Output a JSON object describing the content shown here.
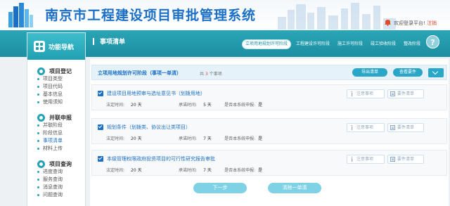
{
  "header": {
    "title": "南京市工程建设项目审批管理系统",
    "welcome": "欢迎登录平台!",
    "logout": "注销"
  },
  "sidebar": {
    "title": "功能导航",
    "groups": [
      {
        "title": "项目登记",
        "items": [
          "项目类型",
          "项目代码",
          "基本信息",
          "使用须知"
        ]
      },
      {
        "title": "并联申报",
        "items": [
          "并联阶段",
          "阶段信息",
          "事项清单",
          "材料上传"
        ]
      },
      {
        "title": "项目查询",
        "items": [
          "进度查询",
          "服务查询",
          "消息查询",
          "问题查询"
        ]
      }
    ],
    "active_item": "事项清单"
  },
  "page": {
    "title": "事项清单",
    "stages": [
      "立项用地规划许可阶段",
      "工程建设许可阶段",
      "施工许可阶段",
      "竣工验收阶段",
      "整改阶段"
    ],
    "active_stage": 0,
    "help": "?"
  },
  "summary": {
    "stage_label": "立项用地规划许可阶段（事项一单清）",
    "count_prefix": "共",
    "count": "3",
    "count_suffix": "个事项",
    "export_label": "导出清单",
    "view_label": "查看要件"
  },
  "items": [
    {
      "name": "建设项目用地预审与选址意见书（划拨用地）",
      "legal_label": "法定时间:",
      "legal": "20 天",
      "promise_label": "承诺时间:",
      "promise": "5 天",
      "online_label": "是否本系统申报:",
      "online": "是",
      "notice": "注意事项",
      "list": "要件清单"
    },
    {
      "name": "规划条件（划拨类、协议出让类项目）",
      "legal_label": "法定时间:",
      "legal": "20 天",
      "promise_label": "承诺时间:",
      "promise": "7 天",
      "online_label": "是否本系统申报:",
      "online": "是",
      "notice": "注意事项",
      "list": "要件清单"
    },
    {
      "name": "本级管理权限政府投资项目的可行性研究报告审批",
      "legal_label": "法定时间:",
      "legal": "20 天",
      "promise_label": "承诺时间:",
      "promise": "7 天",
      "online_label": "是否本系统申报:",
      "online": "是",
      "notice": "注意事项",
      "list": "要件清单"
    }
  ],
  "footer": {
    "next_label": "下一步",
    "clear_label": "清除一单清"
  },
  "colors": {
    "brand": "#1b6fc7",
    "teal": "#21a0b3",
    "accent": "#e24a2c"
  }
}
